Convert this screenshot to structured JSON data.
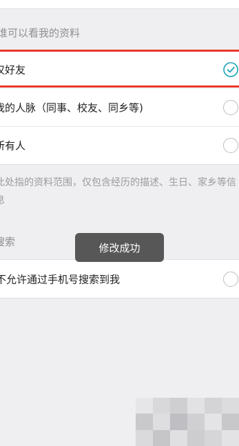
{
  "who_can_view": {
    "header": "谁可以看我的资料",
    "options": [
      {
        "label": "仅好友",
        "selected": true
      },
      {
        "label": "我的人脉（同事、校友、同乡等)",
        "selected": false
      },
      {
        "label": "所有人",
        "selected": false
      }
    ]
  },
  "note": {
    "text": "此处指的资料范围，仅包含经历的描述、生日、家乡等信息"
  },
  "search": {
    "header": "搜索",
    "options": [
      {
        "label": "不允许通过手机号搜索到我",
        "selected": false
      }
    ]
  },
  "toast": {
    "message": "修改成功"
  },
  "colors": {
    "accent": "#17a3b4",
    "highlight": "#e8362a",
    "background": "#efeff1"
  },
  "icons": {
    "selected": "check-circle-icon",
    "unselected": "radio-empty-icon"
  }
}
